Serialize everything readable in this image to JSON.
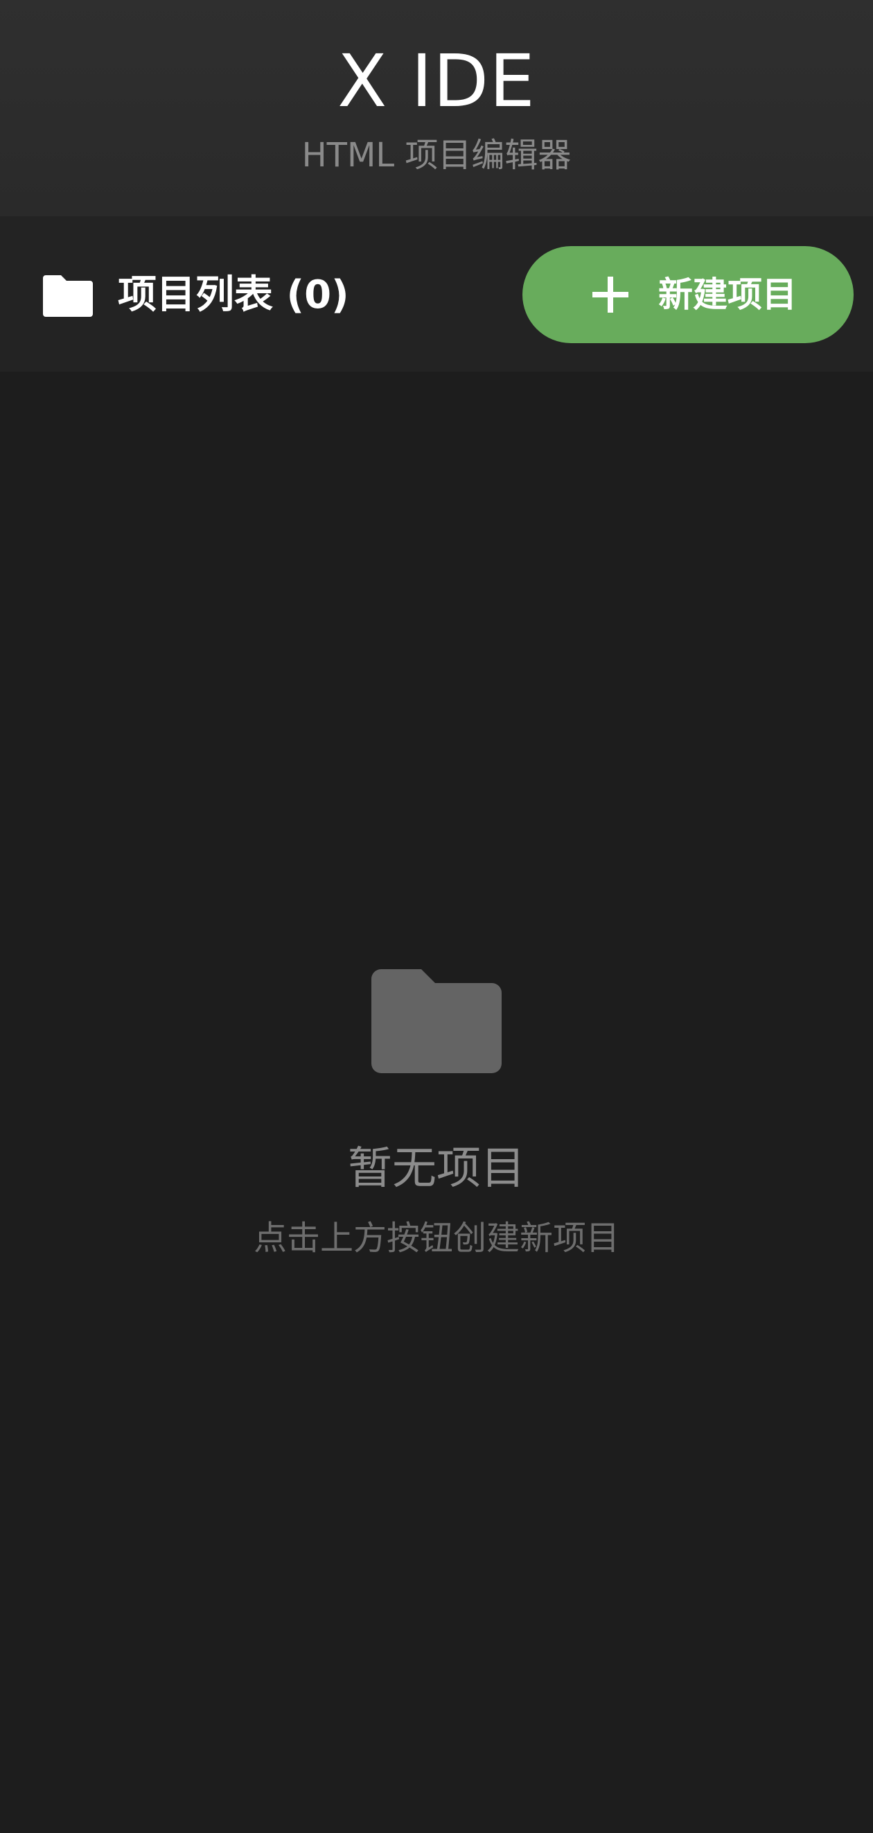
{
  "header": {
    "title": "X IDE",
    "subtitle": "HTML 项目编辑器"
  },
  "toolbar": {
    "list_title": "项目列表 (0)",
    "list_icon": "folder-icon",
    "new_project_label": "新建项目",
    "new_project_icon": "plus-icon"
  },
  "empty_state": {
    "icon": "folder-icon",
    "title": "暂无项目",
    "hint": "点击上方按钮创建新项目"
  },
  "colors": {
    "background": "#1d1d1d",
    "header_background": "#2d2d2d",
    "toolbar_background": "#232323",
    "accent_green": "#68ac5c",
    "muted_text": "#8c8c8c",
    "empty_icon": "#646464"
  }
}
